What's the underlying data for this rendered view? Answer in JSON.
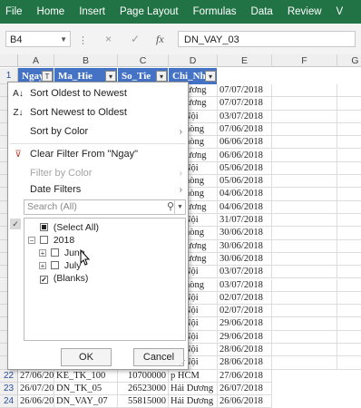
{
  "ribbon": {
    "tabs": [
      "File",
      "Home",
      "Insert",
      "Page Layout",
      "Formulas",
      "Data",
      "Review",
      "V"
    ]
  },
  "formula_bar": {
    "name_box": "B4",
    "cancel_symbol": "×",
    "enter_symbol": "✓",
    "fx_symbol": "fx",
    "formula": "DN_VAY_03"
  },
  "grid": {
    "columns": [
      "A",
      "B",
      "C",
      "D",
      "E",
      "F",
      "G"
    ],
    "header_row_number": "1",
    "headers": [
      "Ngay",
      "Ma_Hie",
      "So_Tie",
      "Chi_Nha"
    ],
    "filter_labels": [
      "T",
      "▾",
      "▾",
      "▾"
    ],
    "rows": [
      {
        "num": "",
        "d": "ải Dương",
        "e": "07/07/2018"
      },
      {
        "num": "",
        "d": "ải Dương",
        "e": "07/07/2018"
      },
      {
        "num": "",
        "d": "Hà Nội",
        "e": "03/07/2018"
      },
      {
        "num": "",
        "d": "ải Phòng",
        "e": "07/06/2018"
      },
      {
        "num": "",
        "d": "ải Phòng",
        "e": "06/06/2018"
      },
      {
        "num": "",
        "d": "ải Dương",
        "e": "06/06/2018"
      },
      {
        "num": "",
        "d": "Hà Nội",
        "e": "05/06/2018"
      },
      {
        "num": "",
        "d": "ải Phòng",
        "e": "05/06/2018"
      },
      {
        "num": "",
        "d": "ải Phòng",
        "e": "04/06/2018"
      },
      {
        "num": "",
        "d": "ải Dương",
        "e": "04/06/2018"
      },
      {
        "num": "",
        "d": "Hà Nội",
        "e": "31/07/2018"
      },
      {
        "num": "",
        "d": "ải Phòng",
        "e": "30/06/2018"
      },
      {
        "num": "",
        "d": "ải Dương",
        "e": "30/06/2018"
      },
      {
        "num": "",
        "d": "ải Dương",
        "e": "30/06/2018"
      },
      {
        "num": "",
        "d": "Hà Nội",
        "e": "03/07/2018"
      },
      {
        "num": "",
        "d": "ải Phòng",
        "e": "03/07/2018"
      },
      {
        "num": "",
        "d": "Hà Nội",
        "e": "02/07/2018"
      },
      {
        "num": "",
        "d": "Hà Nội",
        "e": "02/07/2018"
      },
      {
        "num": "",
        "d": "Hà Nội",
        "e": "29/06/2018"
      },
      {
        "num": "",
        "d": "Hà Nội",
        "e": "29/06/2018"
      },
      {
        "num": "",
        "d": "Hà Nội",
        "e": "28/06/2018"
      },
      {
        "num": "",
        "d": "Hà Nội",
        "e": "28/06/2018"
      }
    ],
    "bottom_rows": [
      {
        "num": "22",
        "a": "27/06/2018",
        "b": "KE_TK_100",
        "c": "10700000",
        "d": "p HCM",
        "e": "27/06/2018"
      },
      {
        "num": "23",
        "a": "26/07/2018",
        "b": "DN_TK_05",
        "c": "26523000",
        "d": "Hải Dương",
        "e": "26/07/2018"
      },
      {
        "num": "24",
        "a": "26/06/2018",
        "b": "DN_VAY_07",
        "c": "55815000",
        "d": "Hải Dương",
        "e": "26/06/2018"
      }
    ]
  },
  "filter_menu": {
    "items": [
      {
        "label": "Sort Oldest to Newest",
        "icon": "A↓",
        "disabled": false
      },
      {
        "label": "Sort Newest to Oldest",
        "icon": "Z↓",
        "disabled": false
      },
      {
        "label": "Sort by Color",
        "arrow": "›",
        "disabled": false
      },
      {
        "label": "Clear Filter From \"Ngay\"",
        "icon": "⊽",
        "disabled": false
      },
      {
        "label": "Filter by Color",
        "arrow": "›",
        "disabled": true
      },
      {
        "label": "Date Filters",
        "arrow": "›",
        "disabled": false
      }
    ],
    "search_placeholder": "Search (All)",
    "tree": [
      {
        "label": "(Select All)",
        "level": 0
      },
      {
        "label": "2018",
        "level": 0
      },
      {
        "label": "June",
        "level": 1
      },
      {
        "label": "July",
        "level": 1
      },
      {
        "label": "(Blanks)",
        "level": 0
      }
    ],
    "ok_label": "OK",
    "cancel_label": "Cancel"
  },
  "colors": {
    "ribbon": "#217346",
    "header_fill": "#4472c4",
    "highlight": "#ffec1e"
  }
}
